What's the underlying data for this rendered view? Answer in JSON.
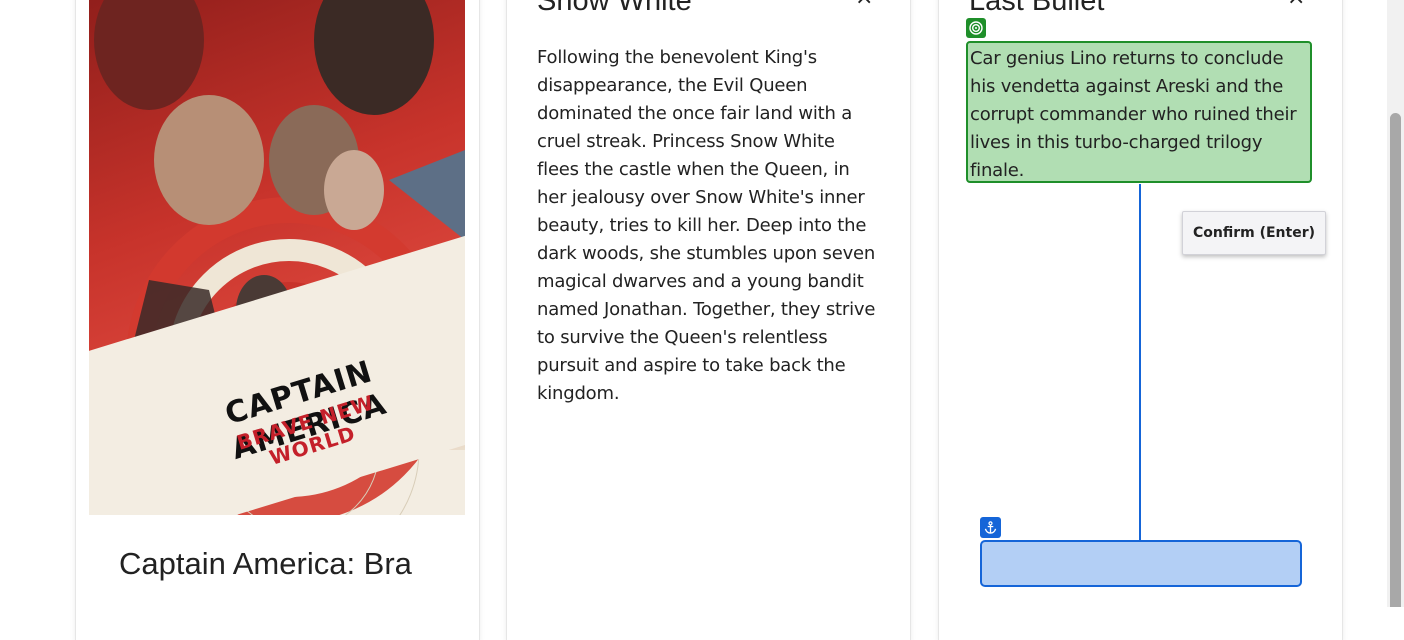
{
  "cards": [
    {
      "title": "Captain America: Bra",
      "poster": {
        "title_main": "CAPTAIN AMERICA",
        "title_sub": "BRAVE NEW WORLD"
      }
    },
    {
      "title": "Snow White",
      "close_icon": "×",
      "description": "Following the benevolent King's disappearance, the Evil Queen dominated the once fair land with a cruel streak. Princess Snow White flees the castle when the Queen, in her jealousy over Snow White's inner beauty, tries to kill her. Deep into the dark woods, she stumbles upon seven magical dwarves and a young bandit named Jonathan. Together, they strive to survive the Queen's relentless pursuit and aspire to take back the kingdom."
    },
    {
      "title": "Last Bullet",
      "close_icon": "×",
      "description": "Car genius Lino returns to conclude his vendetta against Areski and the corrupt commander who ruined their lives in this turbo-charged trilogy finale."
    }
  ],
  "overlay": {
    "target_icon": "target-icon",
    "anchor_icon": "anchor-icon",
    "confirm_label": "Confirm (Enter)",
    "colors": {
      "target": "#1f8f2a",
      "anchor": "#1565d8"
    }
  }
}
